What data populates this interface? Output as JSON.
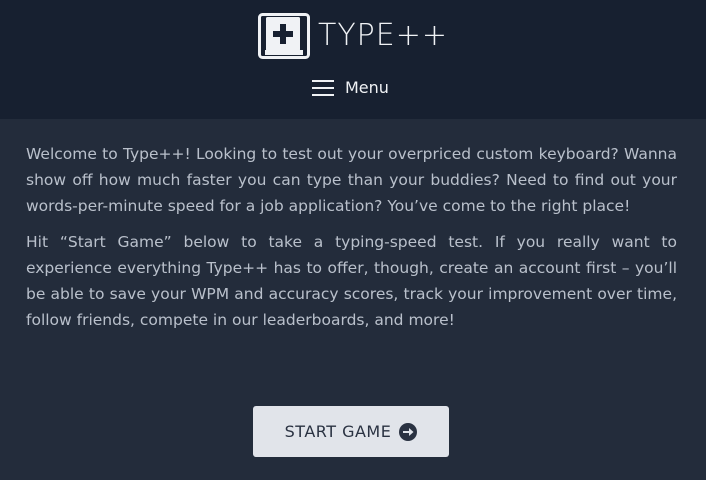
{
  "header": {
    "logo_text": "TYPE++",
    "logo_icon": "plus-key-icon",
    "menu_label": "Menu",
    "menu_icon": "hamburger-icon"
  },
  "main": {
    "paragraphs": [
      "Welcome to Type++! Looking to test out your overpriced custom keyboard? Wanna show off how much faster you can type than your buddies? Need to find out your words-per-minute speed for a job application? You’ve come to the right place!",
      "Hit “Start Game” below to take a typing-speed test. If you really want to experience everything Type++ has to offer, though, create an account first – you’ll be able to save your WPM and accuracy scores, track your improvement over time, follow friends, compete in our leaderboards, and more!"
    ],
    "start_button_label": "START GAME",
    "start_button_icon": "arrow-right-circle-icon"
  },
  "colors": {
    "header_bg": "#172030",
    "page_bg": "#232c3b",
    "body_text": "#b9c0cb",
    "header_text": "#f0f2f5",
    "button_bg": "#e1e4ea",
    "button_text": "#2a3242"
  }
}
